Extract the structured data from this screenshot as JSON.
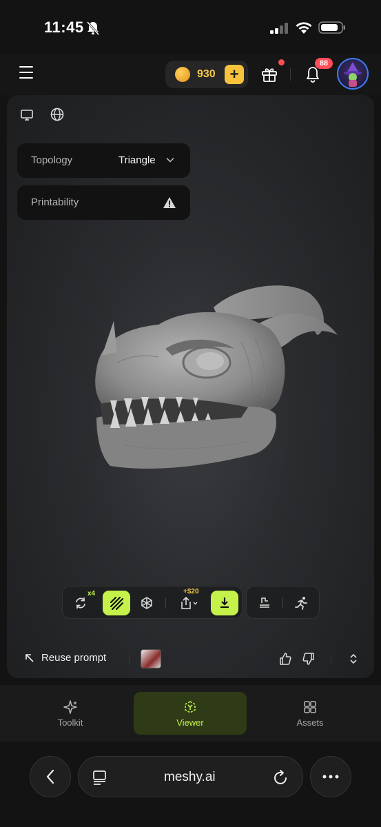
{
  "status_bar": {
    "time": "11:45",
    "icons": [
      "bell-off-icon",
      "signal-icon",
      "wifi-icon",
      "battery-icon"
    ]
  },
  "app_bar": {
    "credits": "930",
    "add_credits_label": "+",
    "notification_count": "88",
    "icons": [
      "menu-icon",
      "coin-icon",
      "gift-icon",
      "bell-icon",
      "avatar"
    ],
    "colors": {
      "credits": "#f7c948",
      "badge": "#ff4d5a",
      "avatar_ring": "#3d7df5"
    }
  },
  "viewer": {
    "view_icons": [
      "monitor-icon",
      "globe-icon"
    ],
    "topology": {
      "label": "Topology",
      "value": "Triangle"
    },
    "printability": {
      "label": "Printability",
      "icon": "warning-icon"
    },
    "toolbar": {
      "regenerate_badge": "x4",
      "export_badge": "+$20",
      "buttons": [
        "refresh-icon",
        "texture-icon",
        "mesh-icon",
        "share-icon",
        "download-icon",
        "remesh-icon",
        "animate-icon"
      ]
    },
    "accent": "#c4f24a",
    "bottom": {
      "reuse_label": "Reuse prompt",
      "icons": [
        "arrow-up-left-icon",
        "thumbs-up-icon",
        "thumbs-down-icon",
        "chevron-up-down-icon"
      ]
    }
  },
  "tabs": [
    {
      "label": "Toolkit",
      "icon": "sparkle-icon"
    },
    {
      "label": "Viewer",
      "icon": "cube-icon",
      "active": true
    },
    {
      "label": "Assets",
      "icon": "grid-icon"
    }
  ],
  "browser": {
    "url": "meshy.ai",
    "icons": [
      "back-icon",
      "tabs-icon",
      "reload-icon",
      "more-icon"
    ]
  }
}
